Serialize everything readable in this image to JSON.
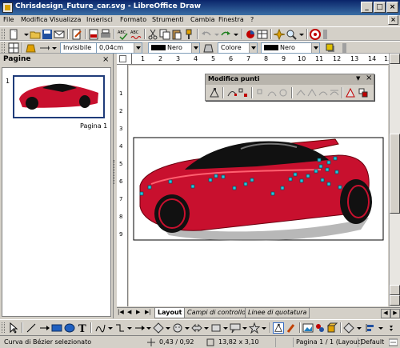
{
  "window": {
    "title": "Chrisdesign_Future_car.svg - LibreOffice Draw"
  },
  "menu": [
    "File",
    "Modifica",
    "Visualizza",
    "Inserisci",
    "Formato",
    "Strumenti",
    "Cambia",
    "Finestra",
    "?"
  ],
  "line_toolbar": {
    "line_style": "Invisibile",
    "line_width": "0,04cm",
    "line_color": "Nero",
    "area_style": "Colore",
    "area_color": "Nero"
  },
  "pages_panel": {
    "title": "Pagine",
    "page_number": "1",
    "page_label": "Pagina 1"
  },
  "ruler": {
    "h_labels": [
      "1",
      "2",
      "3",
      "4",
      "5",
      "6",
      "7",
      "8",
      "9",
      "10",
      "11",
      "12",
      "13",
      "14",
      "15"
    ]
  },
  "points_toolbar": {
    "title": "Modifica punti"
  },
  "tabs": [
    "Layout",
    "Campi di controllo",
    "Linee di quotatura"
  ],
  "status": {
    "selection": "Curva di Bézier selezionato",
    "position": "0,43 / 0,92",
    "size": "13,82 x 3,10",
    "page": "Pagina 1 / 1 (Layout)",
    "style": "Default"
  },
  "colors": {
    "title_start": "#0a246a",
    "title_end": "#3a6ea5",
    "chrome": "#d4d0c8",
    "point_handle": "#26c6da",
    "car_red": "#c8102e"
  }
}
